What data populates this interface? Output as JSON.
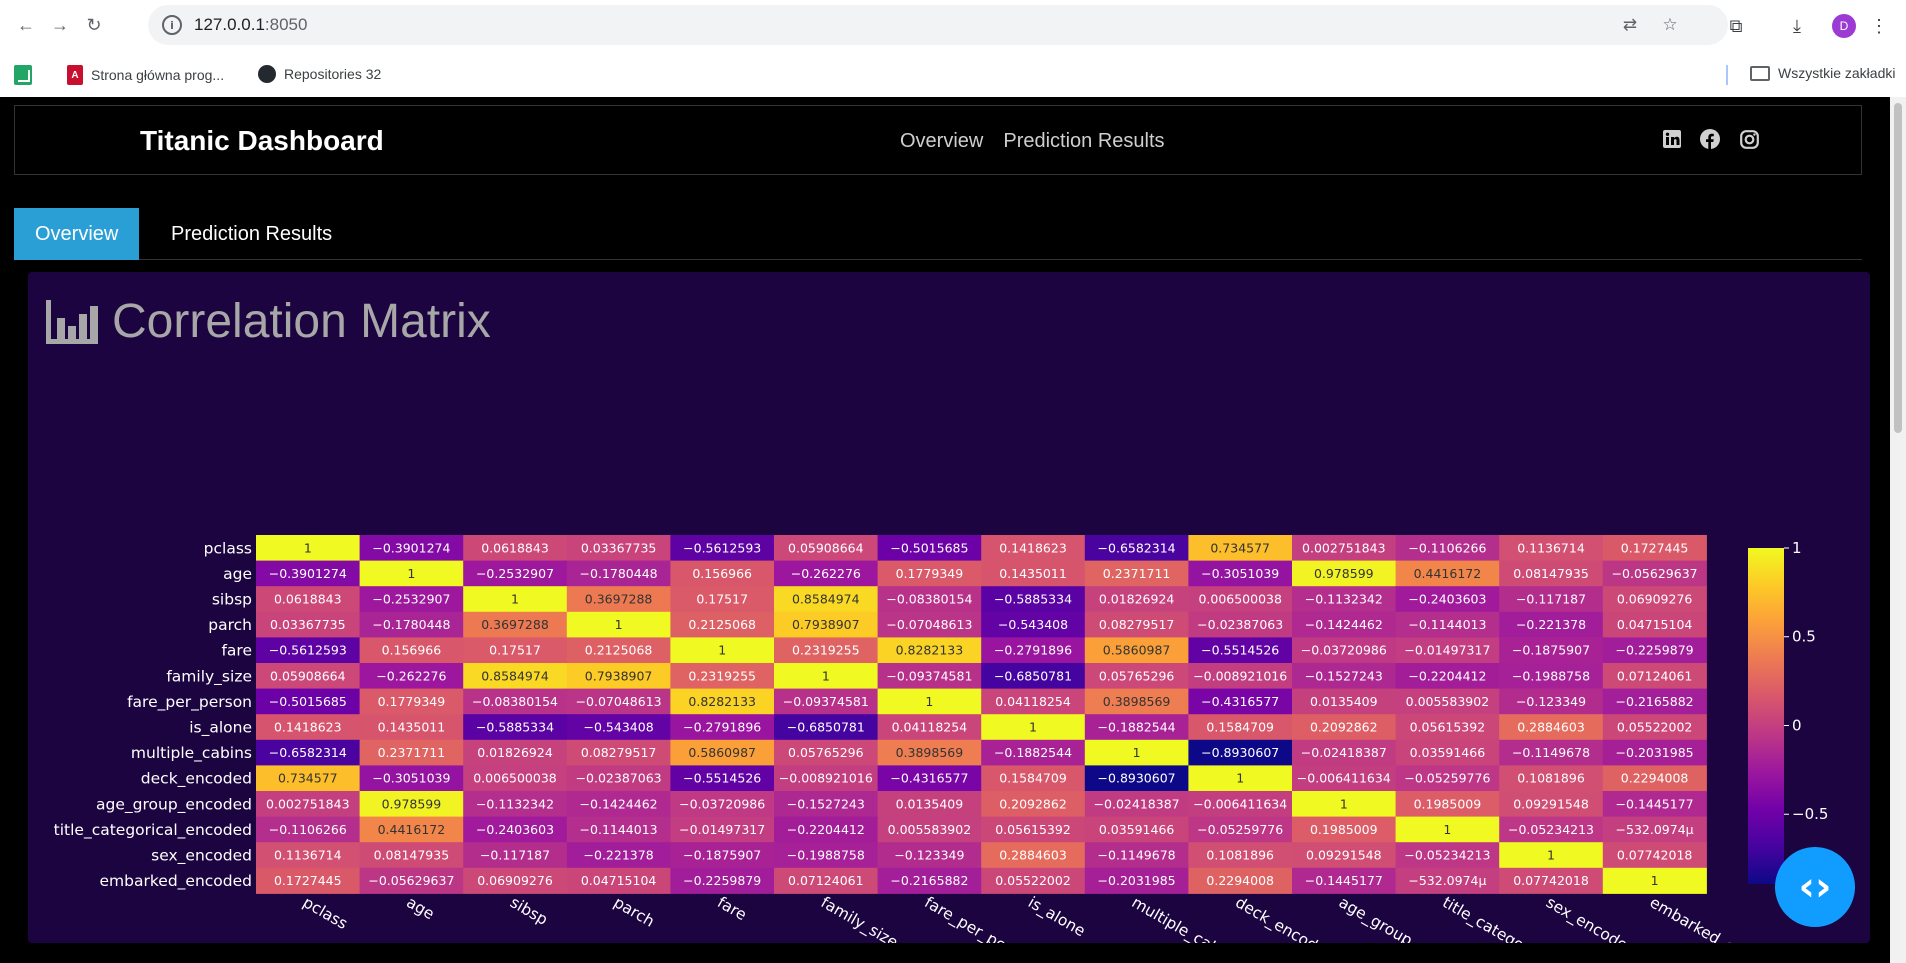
{
  "browser": {
    "url_host": "127.0.0.1",
    "url_port": ":8050",
    "avatar_letter": "D",
    "bookmarks": [
      {
        "label": ""
      },
      {
        "label": "Strona główna prog..."
      },
      {
        "label": "Repositories 32"
      }
    ],
    "all_bookmarks": "Wszystkie zakładki"
  },
  "navbar": {
    "brand": "Titanic Dashboard",
    "links": [
      "Overview",
      "Prediction Results"
    ],
    "social_icons": [
      "linkedin-icon",
      "facebook-icon",
      "instagram-icon"
    ]
  },
  "tabs": [
    {
      "label": "Overview",
      "active": true
    },
    {
      "label": "Prediction Results",
      "active": false
    }
  ],
  "card": {
    "title": "Correlation Matrix",
    "icon": "bar-chart-icon"
  },
  "chart_data": {
    "type": "heatmap",
    "colorscale": "plasma",
    "zrange": [
      -0.8930607,
      1
    ],
    "colorbar_ticks": [
      1,
      0.5,
      0,
      -0.5
    ],
    "labels": [
      "pclass",
      "age",
      "sibsp",
      "parch",
      "fare",
      "family_size",
      "fare_per_person",
      "is_alone",
      "multiple_cabins",
      "deck_encoded",
      "age_group_encoded",
      "title_categorical_encoded",
      "sex_encoded",
      "embarked_encoded"
    ],
    "z": [
      [
        1,
        -0.3901274,
        0.0618843,
        0.03367735,
        -0.5612593,
        0.05908664,
        -0.5015685,
        0.1418623,
        -0.6582314,
        0.734577,
        0.002751843,
        -0.1106266,
        0.1136714,
        0.1727445
      ],
      [
        -0.3901274,
        1,
        -0.2532907,
        -0.1780448,
        0.156966,
        -0.262276,
        0.1779349,
        0.1435011,
        0.2371711,
        -0.3051039,
        0.978599,
        0.4416172,
        0.08147935,
        -0.05629637
      ],
      [
        0.0618843,
        -0.2532907,
        1,
        0.3697288,
        0.17517,
        0.8584974,
        -0.08380154,
        -0.5885334,
        0.01826924,
        0.006500038,
        -0.1132342,
        -0.2403603,
        -0.117187,
        0.06909276
      ],
      [
        0.03367735,
        -0.1780448,
        0.3697288,
        1,
        0.2125068,
        0.7938907,
        -0.07048613,
        -0.543408,
        0.08279517,
        -0.02387063,
        -0.1424462,
        -0.1144013,
        -0.221378,
        0.04715104
      ],
      [
        -0.5612593,
        0.156966,
        0.17517,
        0.2125068,
        1,
        0.2319255,
        0.8282133,
        -0.2791896,
        0.5860987,
        -0.5514526,
        -0.03720986,
        -0.01497317,
        -0.1875907,
        -0.2259879
      ],
      [
        0.05908664,
        -0.262276,
        0.8584974,
        0.7938907,
        0.2319255,
        1,
        -0.09374581,
        -0.6850781,
        0.05765296,
        -0.008921016,
        -0.1527243,
        -0.2204412,
        -0.1988758,
        0.07124061
      ],
      [
        -0.5015685,
        0.1779349,
        -0.08380154,
        -0.07048613,
        0.8282133,
        -0.09374581,
        1,
        0.04118254,
        0.3898569,
        -0.4316577,
        0.0135409,
        0.005583902,
        -0.123349,
        -0.2165882
      ],
      [
        0.1418623,
        0.1435011,
        -0.5885334,
        -0.543408,
        -0.2791896,
        -0.6850781,
        0.04118254,
        1,
        -0.1882544,
        0.1584709,
        0.2092862,
        0.05615392,
        0.2884603,
        0.05522002
      ],
      [
        -0.6582314,
        0.2371711,
        0.01826924,
        0.08279517,
        0.5860987,
        0.05765296,
        0.3898569,
        -0.1882544,
        1,
        -0.8930607,
        -0.02418387,
        0.03591466,
        -0.1149678,
        -0.2031985
      ],
      [
        0.734577,
        -0.3051039,
        0.006500038,
        -0.02387063,
        -0.5514526,
        -0.008921016,
        -0.4316577,
        0.1584709,
        -0.8930607,
        1,
        -0.006411634,
        -0.05259776,
        0.1081896,
        0.2294008
      ],
      [
        0.002751843,
        0.978599,
        -0.1132342,
        -0.1424462,
        -0.03720986,
        -0.1527243,
        0.0135409,
        0.2092862,
        -0.02418387,
        -0.006411634,
        1,
        0.1985009,
        0.09291548,
        -0.1445177
      ],
      [
        -0.1106266,
        0.4416172,
        -0.2403603,
        -0.1144013,
        -0.01497317,
        -0.2204412,
        0.005583902,
        0.05615392,
        0.03591466,
        -0.05259776,
        0.1985009,
        1,
        -0.05234213,
        -0.0005320974
      ],
      [
        0.1136714,
        0.08147935,
        -0.117187,
        -0.221378,
        -0.1875907,
        -0.1988758,
        -0.123349,
        0.2884603,
        -0.1149678,
        0.1081896,
        0.09291548,
        -0.05234213,
        1,
        0.07742018
      ],
      [
        0.1727445,
        -0.05629637,
        0.06909276,
        0.04715104,
        -0.2259879,
        0.07124061,
        -0.2165882,
        0.05522002,
        -0.2031985,
        0.2294008,
        -0.1445177,
        -0.0005320974,
        0.07742018,
        1
      ]
    ],
    "text": [
      [
        "1",
        "−0.3901274",
        "0.0618843",
        "0.03367735",
        "−0.5612593",
        "0.05908664",
        "−0.5015685",
        "0.1418623",
        "−0.6582314",
        "0.734577",
        "0.002751843",
        "−0.1106266",
        "0.1136714",
        "0.1727445"
      ],
      [
        "−0.3901274",
        "1",
        "−0.2532907",
        "−0.1780448",
        "0.156966",
        "−0.262276",
        "0.1779349",
        "0.1435011",
        "0.2371711",
        "−0.3051039",
        "0.978599",
        "0.4416172",
        "0.08147935",
        "−0.05629637"
      ],
      [
        "0.0618843",
        "−0.2532907",
        "1",
        "0.3697288",
        "0.17517",
        "0.8584974",
        "−0.08380154",
        "−0.5885334",
        "0.01826924",
        "0.006500038",
        "−0.1132342",
        "−0.2403603",
        "−0.117187",
        "0.06909276"
      ],
      [
        "0.03367735",
        "−0.1780448",
        "0.3697288",
        "1",
        "0.2125068",
        "0.7938907",
        "−0.07048613",
        "−0.543408",
        "0.08279517",
        "−0.02387063",
        "−0.1424462",
        "−0.1144013",
        "−0.221378",
        "0.04715104"
      ],
      [
        "−0.5612593",
        "0.156966",
        "0.17517",
        "0.2125068",
        "1",
        "0.2319255",
        "0.8282133",
        "−0.2791896",
        "0.5860987",
        "−0.5514526",
        "−0.03720986",
        "−0.01497317",
        "−0.1875907",
        "−0.2259879"
      ],
      [
        "0.05908664",
        "−0.262276",
        "0.8584974",
        "0.7938907",
        "0.2319255",
        "1",
        "−0.09374581",
        "−0.6850781",
        "0.05765296",
        "−0.008921016",
        "−0.1527243",
        "−0.2204412",
        "−0.1988758",
        "0.07124061"
      ],
      [
        "−0.5015685",
        "0.1779349",
        "−0.08380154",
        "−0.07048613",
        "0.8282133",
        "−0.09374581",
        "1",
        "0.04118254",
        "0.3898569",
        "−0.4316577",
        "0.0135409",
        "0.005583902",
        "−0.123349",
        "−0.2165882"
      ],
      [
        "0.1418623",
        "0.1435011",
        "−0.5885334",
        "−0.543408",
        "−0.2791896",
        "−0.6850781",
        "0.04118254",
        "1",
        "−0.1882544",
        "0.1584709",
        "0.2092862",
        "0.05615392",
        "0.2884603",
        "0.05522002"
      ],
      [
        "−0.6582314",
        "0.2371711",
        "0.01826924",
        "0.08279517",
        "0.5860987",
        "0.05765296",
        "0.3898569",
        "−0.1882544",
        "1",
        "−0.8930607",
        "−0.02418387",
        "0.03591466",
        "−0.1149678",
        "−0.2031985"
      ],
      [
        "0.734577",
        "−0.3051039",
        "0.006500038",
        "−0.02387063",
        "−0.5514526",
        "−0.008921016",
        "−0.4316577",
        "0.1584709",
        "−0.8930607",
        "1",
        "−0.006411634",
        "−0.05259776",
        "0.1081896",
        "0.2294008"
      ],
      [
        "0.002751843",
        "0.978599",
        "−0.1132342",
        "−0.1424462",
        "−0.03720986",
        "−0.1527243",
        "0.0135409",
        "0.2092862",
        "−0.02418387",
        "−0.006411634",
        "1",
        "0.1985009",
        "0.09291548",
        "−0.1445177"
      ],
      [
        "−0.1106266",
        "0.4416172",
        "−0.2403603",
        "−0.1144013",
        "−0.01497317",
        "−0.2204412",
        "0.005583902",
        "0.05615392",
        "0.03591466",
        "−0.05259776",
        "0.1985009",
        "1",
        "−0.05234213",
        "−532.0974μ"
      ],
      [
        "0.1136714",
        "0.08147935",
        "−0.117187",
        "−0.221378",
        "−0.1875907",
        "−0.1988758",
        "−0.123349",
        "0.2884603",
        "−0.1149678",
        "0.1081896",
        "0.09291548",
        "−0.05234213",
        "1",
        "0.07742018"
      ],
      [
        "0.1727445",
        "−0.05629637",
        "0.06909276",
        "0.04715104",
        "−0.2259879",
        "0.07124061",
        "−0.2165882",
        "0.05522002",
        "−0.2031985",
        "0.2294008",
        "−0.1445177",
        "−532.0974μ",
        "0.07742018",
        "1"
      ]
    ]
  },
  "fab_icon": "code-brackets-icon",
  "fab_label": "‹›"
}
